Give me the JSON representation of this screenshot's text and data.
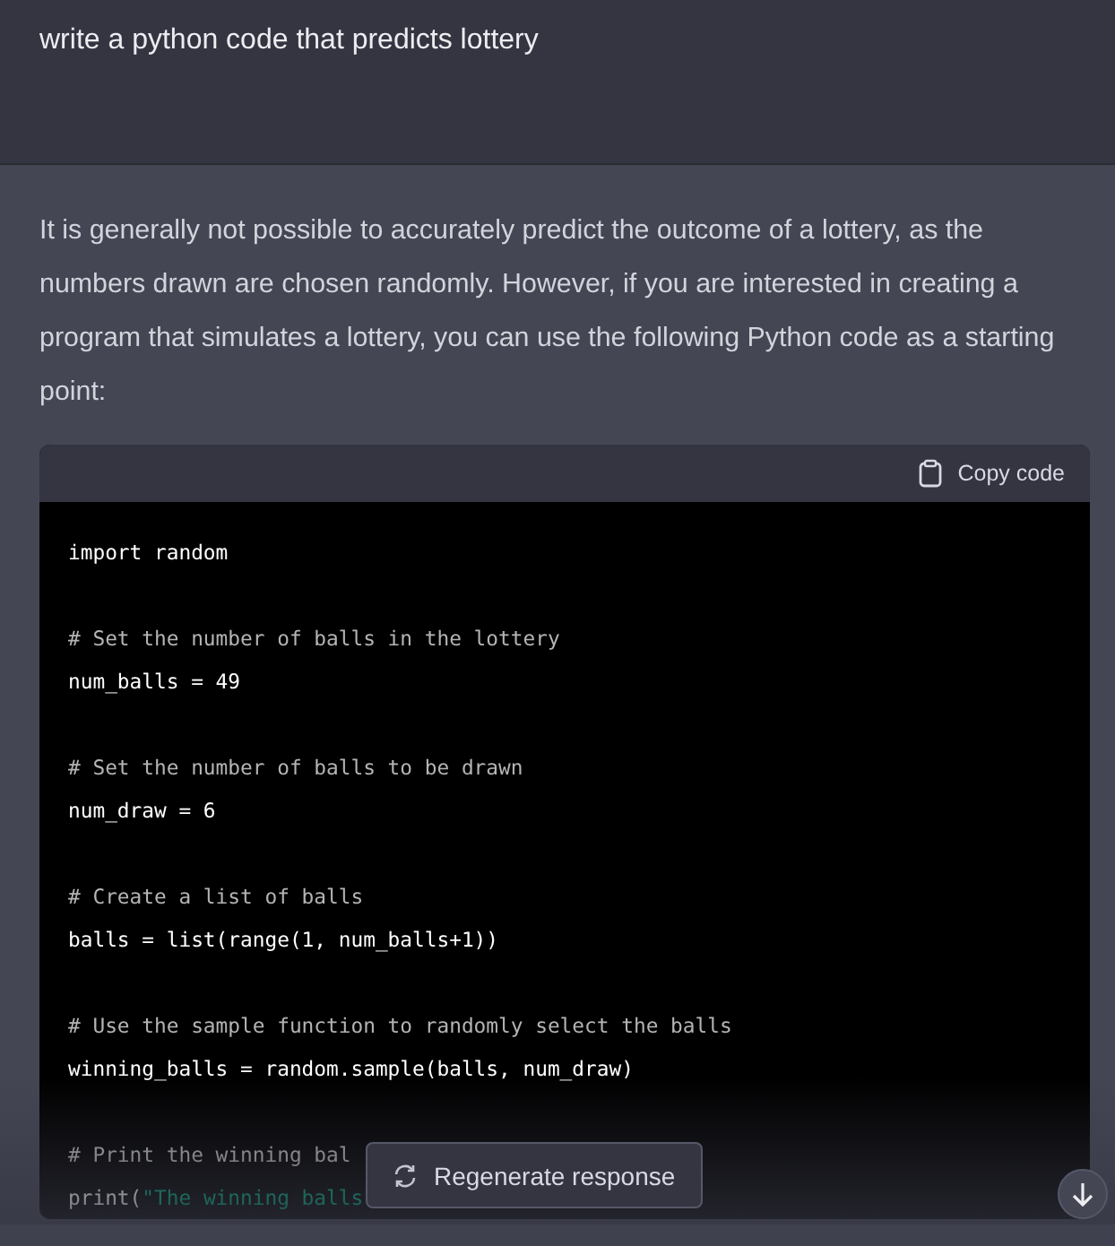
{
  "prompt": {
    "text": "write a python code that predicts lottery"
  },
  "response": {
    "text": "It is generally not possible to accurately predict the outcome of a lottery, as the numbers drawn are chosen randomly. However, if you are interested in creating a program that simulates a lottery, you can use the following Python code as a starting point:",
    "code_block": {
      "copy_label": "Copy code",
      "blocks": [
        [
          [
            {
              "kind": "plain",
              "text": "import random"
            }
          ]
        ],
        [
          [
            {
              "kind": "comment",
              "text": "# Set the number of balls in the lottery"
            }
          ],
          [
            {
              "kind": "plain",
              "text": "num_balls = 49"
            }
          ]
        ],
        [
          [
            {
              "kind": "comment",
              "text": "# Set the number of balls to be drawn"
            }
          ],
          [
            {
              "kind": "plain",
              "text": "num_draw = 6"
            }
          ]
        ],
        [
          [
            {
              "kind": "comment",
              "text": "# Create a list of balls"
            }
          ],
          [
            {
              "kind": "plain",
              "text": "balls = list(range(1, num_balls+1))"
            }
          ]
        ],
        [
          [
            {
              "kind": "comment",
              "text": "# Use the sample function to randomly select the balls"
            }
          ],
          [
            {
              "kind": "plain",
              "text": "winning_balls = random.sample(balls, num_draw)"
            }
          ]
        ],
        [
          [
            {
              "kind": "comment",
              "text": "# Print the winning bal"
            }
          ],
          [
            {
              "kind": "plain",
              "text": "print("
            },
            {
              "kind": "string",
              "text": "\"The winning balls"
            }
          ]
        ]
      ]
    }
  },
  "regenerate_button": {
    "label": "Regenerate response"
  }
}
